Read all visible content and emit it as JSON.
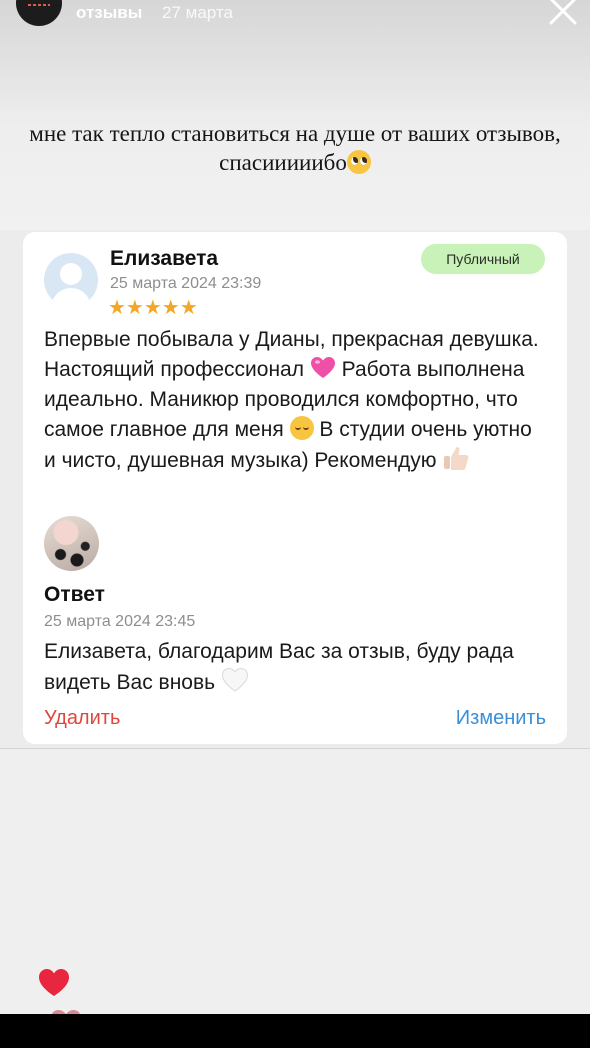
{
  "story": {
    "username": "отзывы",
    "date": "27 марта",
    "caption": "мне так тепло становиться на душе от ваших отзывов, спасииииибо"
  },
  "review": {
    "name": "Елизавета",
    "date": "25 марта 2024 23:39",
    "stars": "★★★★★",
    "rating": 5,
    "badge": "Публичный",
    "text_parts": [
      "Впервые побывала у Дианы, прекрасная девушка. Настоящий профессионал ",
      " Работа выполнена идеально. Маникюр проводился комфортно, что самое главное для меня ",
      " В студии очень уютно и чисто, душевная музыка) Рекомендую "
    ]
  },
  "answer": {
    "title": "Ответ",
    "date": "25 марта 2024 23:45",
    "text": "Елизавета, благодарим Вас за отзыв, буду рада видеть Вас вновь "
  },
  "actions": {
    "delete_label": "Удалить",
    "edit_label": "Изменить"
  },
  "colors": {
    "badge_bg": "#c9f2b8",
    "stars": "#f5a623",
    "delete": "#e0473c",
    "edit": "#3a8fd6",
    "reaction_heart": "#e8263f"
  },
  "icons": {
    "close": "close-icon",
    "reaction": "heart-icon"
  }
}
